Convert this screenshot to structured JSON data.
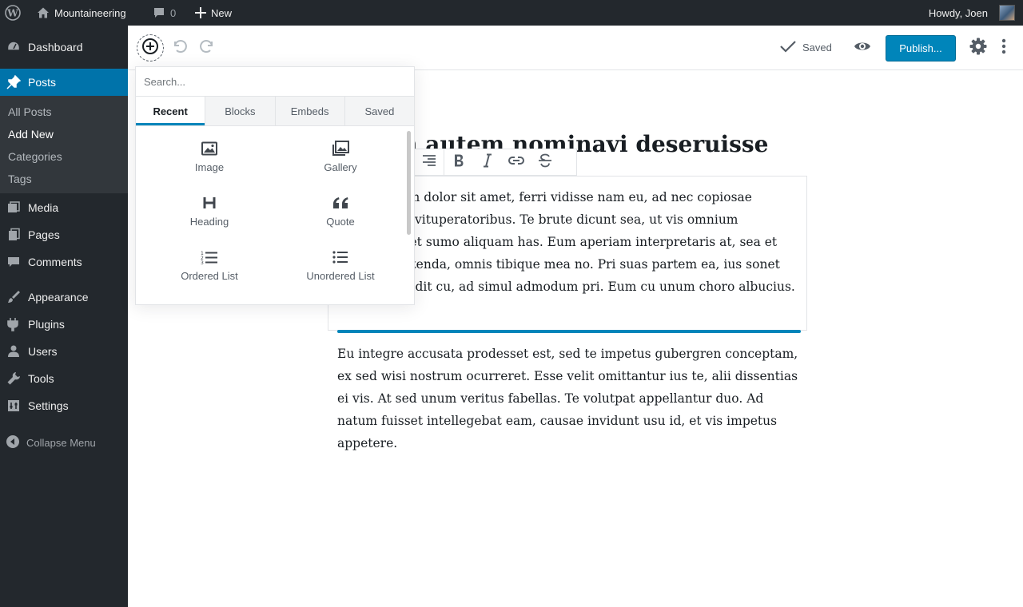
{
  "adminbar": {
    "site_name": "Mountaineering",
    "comments_count": "0",
    "new_label": "New",
    "howdy": "Howdy, Joen"
  },
  "sidebar": {
    "items": [
      {
        "label": "Dashboard",
        "icon": "dashboard-icon"
      },
      {
        "label": "Posts",
        "icon": "pin-icon"
      },
      {
        "label": "Media",
        "icon": "media-icon"
      },
      {
        "label": "Pages",
        "icon": "pages-icon"
      },
      {
        "label": "Comments",
        "icon": "comments-icon"
      },
      {
        "label": "Appearance",
        "icon": "brush-icon"
      },
      {
        "label": "Plugins",
        "icon": "plugin-icon"
      },
      {
        "label": "Users",
        "icon": "users-icon"
      },
      {
        "label": "Tools",
        "icon": "wrench-icon"
      },
      {
        "label": "Settings",
        "icon": "settings-icon"
      }
    ],
    "submenu": [
      "All Posts",
      "Add New",
      "Categories",
      "Tags"
    ],
    "collapse": "Collapse Menu"
  },
  "header": {
    "saved": "Saved",
    "publish": "Publish..."
  },
  "inserter": {
    "search_placeholder": "Search...",
    "tabs": [
      "Recent",
      "Blocks",
      "Embeds",
      "Saved"
    ],
    "blocks": [
      {
        "label": "Image",
        "icon": "image-icon"
      },
      {
        "label": "Gallery",
        "icon": "gallery-icon"
      },
      {
        "label": "Heading",
        "icon": "heading-icon"
      },
      {
        "label": "Quote",
        "icon": "quote-icon"
      },
      {
        "label": "Ordered List",
        "icon": "ordered-list-icon"
      },
      {
        "label": "Unordered List",
        "icon": "unordered-list-icon"
      }
    ]
  },
  "post": {
    "title": "Lorem autem nominavi deseruisse",
    "paragraph1": "Lorem ipsum dolor sit amet, ferri vidisse nam eu, ad nec copiosae assentior in vituperatoribus. Te brute dicunt sea, ut vis omnium maiestatis, et sumo aliquam has. Eum aperiam interpretaris at, sea et postea repetenda, omnis tibique mea no. Pri suas partem ea, ius sonet aperiri offendit cu, ad simul admodum pri. Eum cu unum choro albucius.",
    "paragraph2": "Eu integre accusata prodesset est, sed te impetus gubergren conceptam, ex sed wisi nostrum ocurreret. Esse velit omittantur ius te, alii dissentias ei vis. At sed unum veritus fabellas. Te volutpat appellantur duo. Ad natum fuisset intellegebat eam, causae invidunt usu id, et vis impetus appetere."
  }
}
